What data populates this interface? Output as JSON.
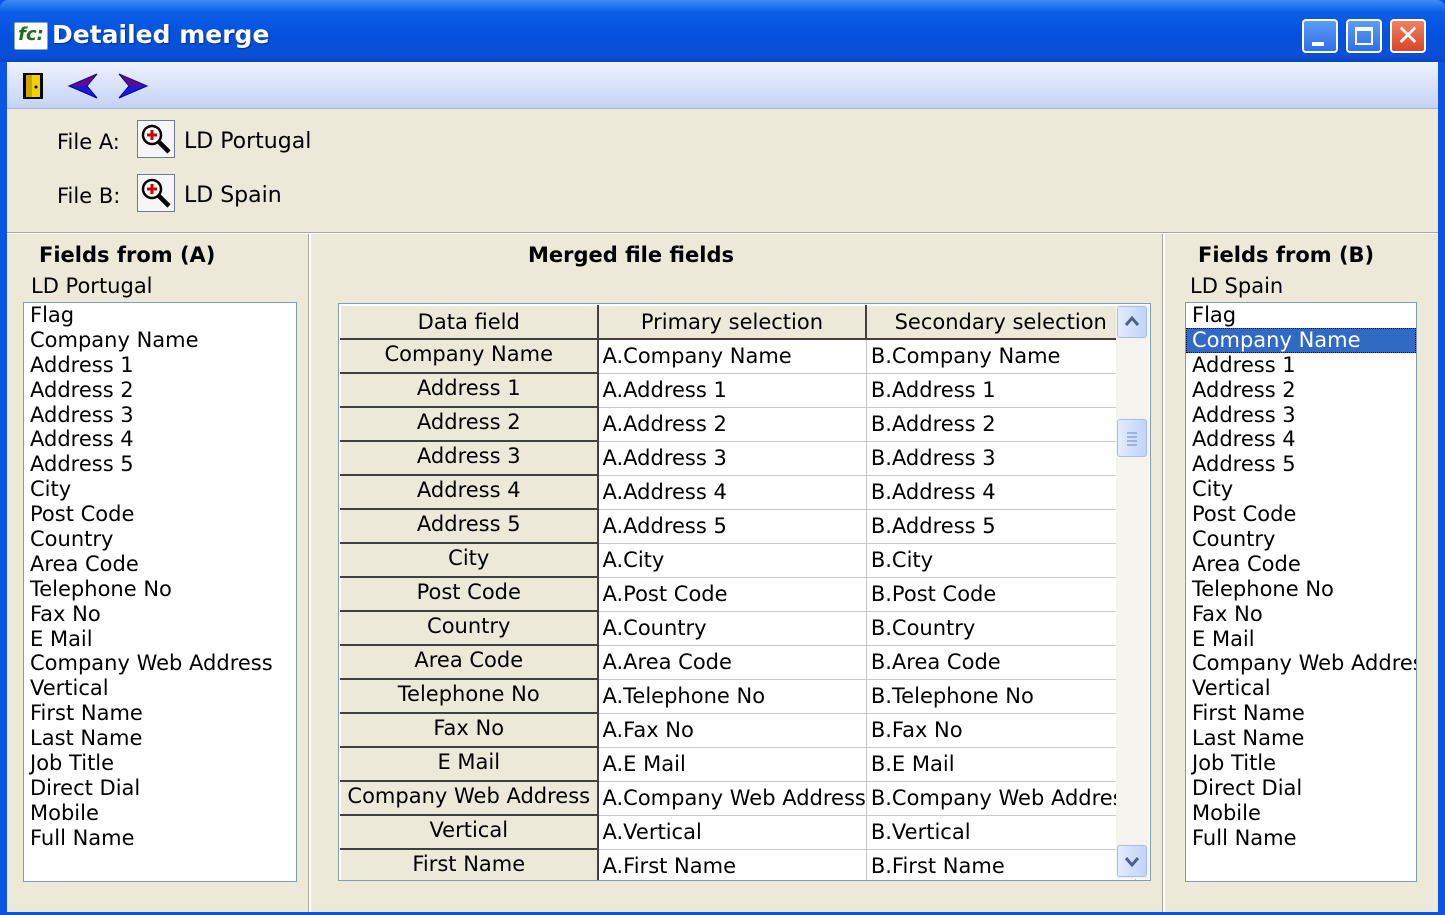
{
  "window": {
    "title": "Detailed merge",
    "app_icon_text": "fc:"
  },
  "files": {
    "file_a_label": "File A:",
    "file_a_value": "LD Portugal",
    "file_b_label": "File B:",
    "file_b_value": "LD Spain"
  },
  "left_panel": {
    "heading": "Fields from (A)",
    "subheading": "LD Portugal",
    "items": [
      "Flag",
      "Company Name",
      "Address 1",
      "Address 2",
      "Address 3",
      "Address 4",
      "Address 5",
      "City",
      "Post Code",
      "Country",
      "Area Code",
      "Telephone No",
      "Fax No",
      "E Mail",
      "Company Web Address",
      "Vertical",
      "First Name",
      "Last Name",
      "Job Title",
      "Direct Dial",
      "Mobile",
      "Full Name"
    ]
  },
  "middle_panel": {
    "heading": "Merged file fields",
    "columns": [
      "Data field",
      "Primary selection",
      "Secondary selection"
    ],
    "rows": [
      [
        "Company Name",
        "A.Company Name",
        "B.Company Name"
      ],
      [
        "Address 1",
        "A.Address 1",
        "B.Address 1"
      ],
      [
        "Address 2",
        "A.Address 2",
        "B.Address 2"
      ],
      [
        "Address 3",
        "A.Address 3",
        "B.Address 3"
      ],
      [
        "Address 4",
        "A.Address 4",
        "B.Address 4"
      ],
      [
        "Address 5",
        "A.Address 5",
        "B.Address 5"
      ],
      [
        "City",
        "A.City",
        "B.City"
      ],
      [
        "Post Code",
        "A.Post Code",
        "B.Post Code"
      ],
      [
        "Country",
        "A.Country",
        "B.Country"
      ],
      [
        "Area Code",
        "A.Area Code",
        "B.Area Code"
      ],
      [
        "Telephone No",
        "A.Telephone No",
        "B.Telephone No"
      ],
      [
        "Fax No",
        "A.Fax No",
        "B.Fax No"
      ],
      [
        "E Mail",
        "A.E Mail",
        "B.E Mail"
      ],
      [
        "Company Web Address",
        "A.Company Web Address",
        "B.Company Web Address"
      ],
      [
        "Vertical",
        "A.Vertical",
        "B.Vertical"
      ],
      [
        "First Name",
        "A.First Name",
        "B.First Name"
      ]
    ]
  },
  "right_panel": {
    "heading": "Fields from (B)",
    "subheading": "LD Spain",
    "selected_index": 1,
    "items": [
      "Flag",
      "Company Name",
      "Address 1",
      "Address 2",
      "Address 3",
      "Address 4",
      "Address 5",
      "City",
      "Post Code",
      "Country",
      "Area Code",
      "Telephone No",
      "Fax No",
      "E Mail",
      "Company Web Address",
      "Vertical",
      "First Name",
      "Last Name",
      "Job Title",
      "Direct Dial",
      "Mobile",
      "Full Name"
    ]
  },
  "icons": {
    "exit": "exit-door-icon",
    "back": "arrow-left-icon",
    "forward": "arrow-right-icon",
    "zoom": "magnifier-plus-icon"
  },
  "colors": {
    "title_bar": "#0550dc",
    "selection": "#316ac5",
    "face": "#ece9d8",
    "arrow": "#1a1adb"
  }
}
